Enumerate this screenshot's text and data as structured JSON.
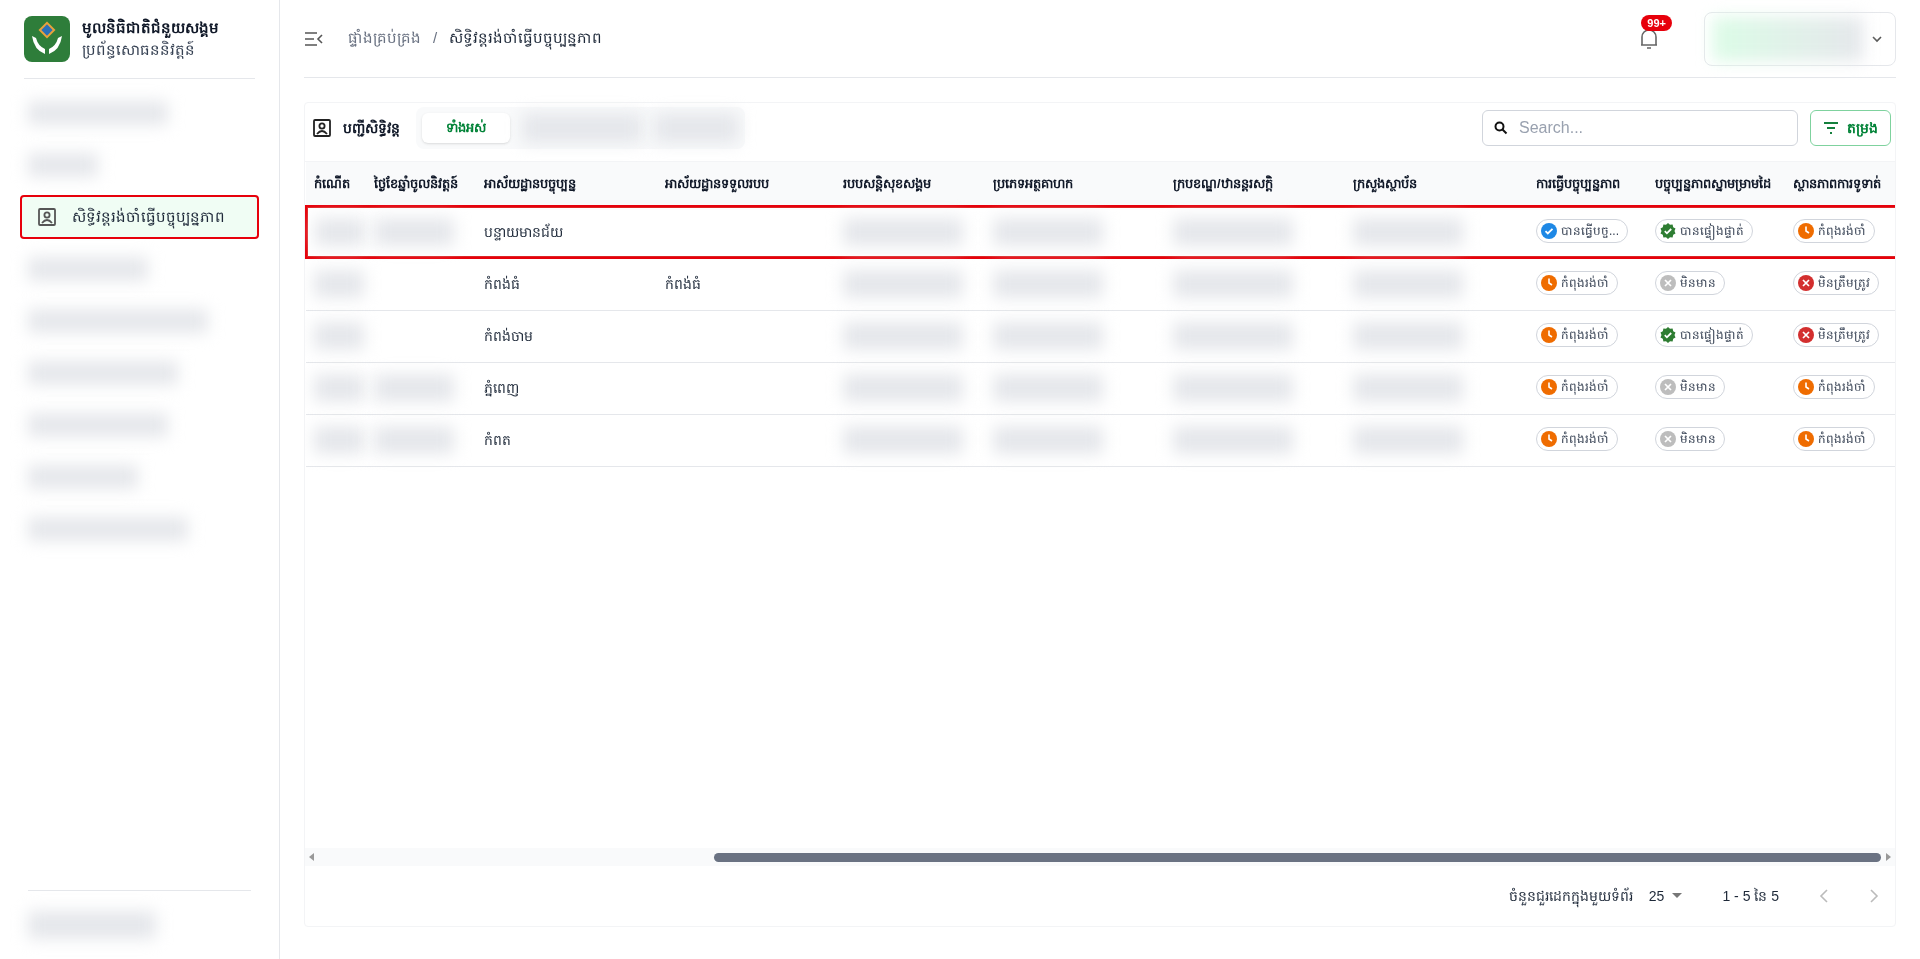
{
  "app": {
    "title": "មូលនិធិជាតិជំនួយសង្គម",
    "subtitle": "ប្រព័ន្ធសោធននិវត្តន៍"
  },
  "sidebar": {
    "items": [
      {
        "kind": "blurred",
        "selected": false,
        "highlighted": false
      },
      {
        "kind": "blurred",
        "selected": false,
        "highlighted": false
      },
      {
        "kind": "item",
        "label": "សិទ្ធិវន្តរង់ចាំធ្វើបច្ចុប្បន្នភាព",
        "selected": true,
        "highlighted": true
      },
      {
        "kind": "blurred",
        "selected": false,
        "highlighted": false
      },
      {
        "kind": "blurred",
        "selected": false,
        "highlighted": false
      },
      {
        "kind": "blurred",
        "selected": false,
        "highlighted": false
      },
      {
        "kind": "blurred",
        "selected": false,
        "highlighted": false
      },
      {
        "kind": "blurred",
        "selected": false,
        "highlighted": false
      },
      {
        "kind": "blurred",
        "selected": false,
        "highlighted": false
      }
    ]
  },
  "breadcrumb": {
    "items": [
      "ផ្ទាំងគ្រប់គ្រង",
      "សិទ្ធិវន្តរង់ចាំធ្វើបច្ចុប្បន្នភាព"
    ],
    "separator": "/"
  },
  "notifications": {
    "badge": "99+"
  },
  "list": {
    "title": "បញ្ជីសិទ្ធិវន្ត",
    "tabs": [
      {
        "kind": "label",
        "label": "ទាំងអស់",
        "selected": true
      },
      {
        "kind": "blurred",
        "selected": false
      },
      {
        "kind": "blurred",
        "selected": false
      }
    ],
    "search": {
      "placeholder": "Search..."
    },
    "filter_button": "តម្រង"
  },
  "table": {
    "columns": [
      "កំណើត",
      "ថ្ងៃខែឆ្នាំចូលនិវត្តន៍",
      "អាស័យដ្ឋានបច្ចុប្បន្ន",
      "អាស័យដ្ឋានទទួលរបប",
      "របបសន្តិសុខសង្គម",
      "ប្រភេទអត្ថគាហក",
      "ក្របខណ្ឌ/ឋានន្តរសក្តិ",
      "ក្រសួងស្ថាប័ន",
      "ការធ្វើបច្ចុប្បន្នភាព",
      "បច្ចុប្បន្នភាពស្នាមម្រាមដៃ",
      "ស្ថានភាពការទូទាត់"
    ],
    "rows": [
      {
        "highlighted": true,
        "cells": [
          {
            "kind": "blurred"
          },
          {
            "kind": "blurred"
          },
          {
            "kind": "text",
            "text": "បន្ទាយមានជ័យ"
          },
          {
            "kind": "empty"
          },
          {
            "kind": "blurred"
          },
          {
            "kind": "blurred"
          },
          {
            "kind": "blurred"
          },
          {
            "kind": "blurred"
          },
          {
            "kind": "done",
            "text": "បានធ្វើបច្ច..."
          },
          {
            "kind": "verified",
            "text": "បានផ្ទៀងផ្ទាត់"
          },
          {
            "kind": "pending",
            "text": "កំពុងរង់ចាំ"
          }
        ]
      },
      {
        "highlighted": false,
        "cells": [
          {
            "kind": "blurred"
          },
          {
            "kind": "empty"
          },
          {
            "kind": "text",
            "text": "កំពង់ធំ"
          },
          {
            "kind": "text",
            "text": "កំពង់ធំ"
          },
          {
            "kind": "blurred"
          },
          {
            "kind": "blurred"
          },
          {
            "kind": "blurred"
          },
          {
            "kind": "blurred"
          },
          {
            "kind": "pending",
            "text": "កំពុងរង់ចាំ"
          },
          {
            "kind": "none",
            "text": "មិនមាន"
          },
          {
            "kind": "invalid",
            "text": "មិនត្រឹមត្រូវ"
          }
        ]
      },
      {
        "highlighted": false,
        "cells": [
          {
            "kind": "blurred"
          },
          {
            "kind": "empty"
          },
          {
            "kind": "text",
            "text": "កំពង់ចាម"
          },
          {
            "kind": "empty"
          },
          {
            "kind": "blurred"
          },
          {
            "kind": "blurred"
          },
          {
            "kind": "blurred"
          },
          {
            "kind": "blurred"
          },
          {
            "kind": "pending",
            "text": "កំពុងរង់ចាំ"
          },
          {
            "kind": "verified",
            "text": "បានផ្ទៀងផ្ទាត់"
          },
          {
            "kind": "invalid",
            "text": "មិនត្រឹមត្រូវ"
          }
        ]
      },
      {
        "highlighted": false,
        "cells": [
          {
            "kind": "blurred"
          },
          {
            "kind": "blurred"
          },
          {
            "kind": "text",
            "text": "ភ្នំពេញ"
          },
          {
            "kind": "empty"
          },
          {
            "kind": "blurred"
          },
          {
            "kind": "blurred"
          },
          {
            "kind": "blurred"
          },
          {
            "kind": "blurred"
          },
          {
            "kind": "pending",
            "text": "កំពុងរង់ចាំ"
          },
          {
            "kind": "none",
            "text": "មិនមាន"
          },
          {
            "kind": "pending",
            "text": "កំពុងរង់ចាំ"
          }
        ]
      },
      {
        "highlighted": false,
        "cells": [
          {
            "kind": "blurred"
          },
          {
            "kind": "blurred"
          },
          {
            "kind": "text",
            "text": "កំពត"
          },
          {
            "kind": "empty"
          },
          {
            "kind": "blurred"
          },
          {
            "kind": "blurred"
          },
          {
            "kind": "blurred"
          },
          {
            "kind": "blurred"
          },
          {
            "kind": "pending",
            "text": "កំពុងរង់ចាំ"
          },
          {
            "kind": "none",
            "text": "មិនមាន"
          },
          {
            "kind": "pending",
            "text": "កំពុងរង់ចាំ"
          }
        ]
      }
    ]
  },
  "pagination": {
    "rows_per_page_label": "ចំនួនជួរដេកក្នុងមួយទំព័រ",
    "rows_per_page": "25",
    "range": "1 - 5 នៃ 5"
  }
}
